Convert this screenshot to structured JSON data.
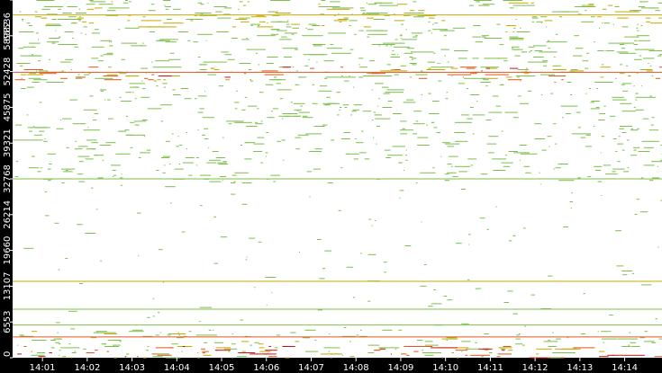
{
  "chart_data": {
    "type": "heatmap",
    "title": "",
    "xlabel": "",
    "ylabel": "",
    "x_ticks": [
      "14:01",
      "14:02",
      "14:03",
      "14:04",
      "14:05",
      "14:06",
      "14:07",
      "14:08",
      "14:09",
      "14:10",
      "14:11",
      "14:12",
      "14:13",
      "14:14"
    ],
    "x_range": [
      "14:00:20",
      "14:14:50"
    ],
    "y_ticks": [
      0,
      6553,
      13107,
      19660,
      26214,
      32768,
      39321,
      45875,
      52428,
      58982,
      65536
    ],
    "y_range": [
      0,
      65536
    ],
    "grid": false,
    "colors": {
      "background": "#000000",
      "plot_background": "#ffffff",
      "low": "#7cbf4a",
      "mid": "#c8a800",
      "high": "#e0561c",
      "peak": "#d01010",
      "axis_text": "#ffffff"
    },
    "density_bands": [
      {
        "from": 0,
        "to": 2200,
        "density": 0.95,
        "heat": 0.85
      },
      {
        "from": 2200,
        "to": 5200,
        "density": 0.55,
        "heat": 0.35
      },
      {
        "from": 5200,
        "to": 11000,
        "density": 0.06,
        "heat": 0.1
      },
      {
        "from": 11000,
        "to": 20000,
        "density": 0.1,
        "heat": 0.15
      },
      {
        "from": 20000,
        "to": 32000,
        "density": 0.08,
        "heat": 0.1
      },
      {
        "from": 32000,
        "to": 33500,
        "density": 0.35,
        "heat": 0.15
      },
      {
        "from": 33500,
        "to": 46000,
        "density": 0.4,
        "heat": 0.2
      },
      {
        "from": 46000,
        "to": 51000,
        "density": 0.45,
        "heat": 0.25
      },
      {
        "from": 51000,
        "to": 53500,
        "density": 0.9,
        "heat": 0.75
      },
      {
        "from": 53500,
        "to": 60500,
        "density": 0.55,
        "heat": 0.3
      },
      {
        "from": 60500,
        "to": 63000,
        "density": 0.75,
        "heat": 0.5
      },
      {
        "from": 63000,
        "to": 65536,
        "density": 0.65,
        "heat": 0.35
      }
    ],
    "horizontal_lines": [
      {
        "port": 32768,
        "color": "low"
      },
      {
        "port": 14000,
        "color": "mid"
      },
      {
        "port": 8900,
        "color": "low"
      },
      {
        "port": 6000,
        "color": "low"
      },
      {
        "port": 52300,
        "color": "high"
      },
      {
        "port": 62800,
        "color": "mid"
      },
      {
        "port": 3800,
        "color": "high"
      }
    ]
  }
}
